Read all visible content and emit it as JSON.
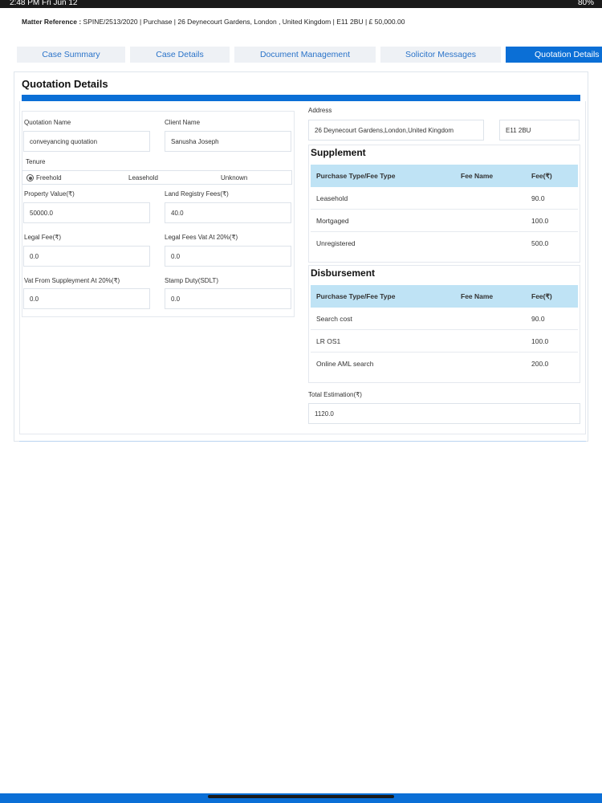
{
  "status": {
    "time": "2:48 PM   Fri Jun 12",
    "battery": "80%"
  },
  "matter": {
    "label": "Matter Reference :",
    "value": "SPINE/2513/2020 | Purchase | 26 Deynecourt Gardens, London , United Kingdom | E11 2BU | £ 50,000.00"
  },
  "tabs": [
    {
      "label": "Case Summary"
    },
    {
      "label": "Case Details"
    },
    {
      "label": "Document Management"
    },
    {
      "label": "Solicitor Messages"
    },
    {
      "label": "Quotation Details",
      "active": true
    }
  ],
  "panel": {
    "title": "Quotation Details"
  },
  "form": {
    "quotation_name": {
      "label": "Quotation Name",
      "value": "conveyancing quotation"
    },
    "client_name": {
      "label": "Client Name",
      "value": "Sanusha Joseph"
    },
    "tenure": {
      "label": "Tenure",
      "options": [
        "Freehold",
        "Leasehold",
        "Unknown"
      ],
      "selected": "Freehold"
    },
    "property_value": {
      "label": "Property Value(₹)",
      "value": "50000.0"
    },
    "land_registry_fees": {
      "label": "Land Registry Fees(₹)",
      "value": "40.0"
    },
    "legal_fee": {
      "label": "Legal Fee(₹)",
      "value": "0.0"
    },
    "legal_fees_vat": {
      "label": "Legal Fees Vat At 20%(₹)",
      "value": "0.0"
    },
    "vat_supplement": {
      "label": "Vat From Suppleyment At 20%(₹)",
      "value": "0.0"
    },
    "stamp_duty": {
      "label": "Stamp Duty(SDLT)",
      "value": "0.0"
    },
    "address": {
      "label": "Address",
      "value": "26 Deynecourt Gardens,London,United Kingdom",
      "postcode": "E11 2BU"
    },
    "total_estimation": {
      "label": "Total Estimation(₹)",
      "value": "1120.0"
    }
  },
  "supplement": {
    "title": "Supplement",
    "headers": [
      "Purchase Type/Fee Type",
      "Fee Name",
      "Fee(₹)"
    ],
    "rows": [
      {
        "type": "Leasehold",
        "name": "",
        "fee": "90.0"
      },
      {
        "type": "Mortgaged",
        "name": "",
        "fee": "100.0"
      },
      {
        "type": "Unregistered",
        "name": "",
        "fee": "500.0"
      }
    ]
  },
  "disbursement": {
    "title": "Disbursement",
    "headers": [
      "Purchase Type/Fee Type",
      "Fee Name",
      "Fee(₹)"
    ],
    "rows": [
      {
        "type": "Search cost",
        "name": "",
        "fee": "90.0"
      },
      {
        "type": "LR OS1",
        "name": "",
        "fee": "100.0"
      },
      {
        "type": "Online AML search",
        "name": "",
        "fee": "200.0"
      }
    ]
  },
  "colors": {
    "accent": "#0b6fd6",
    "table_header": "#bfe3f5",
    "tab_bg": "#eef1f5"
  }
}
